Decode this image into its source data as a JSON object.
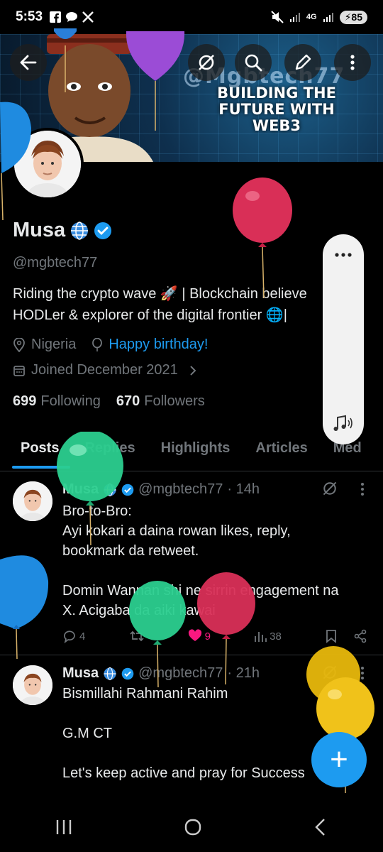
{
  "status_bar": {
    "time": "5:53",
    "network": "4G",
    "battery": "85"
  },
  "banner": {
    "handle_watermark": "@Mgbtech77",
    "title": "BUILDING THE\nFUTURE WITH\nWEB3"
  },
  "profile": {
    "display_name": "Musa",
    "handle": "@mgbtech77",
    "bio_line1": "Riding the crypto wave 🚀  | Blockchain believe",
    "bio_line2": "HODLer & explorer of the digital frontier 🌐|",
    "location": "Nigeria",
    "birthday_link": "Happy birthday!",
    "joined": "Joined December 2021",
    "following_count": "699",
    "following_label": "Following",
    "followers_count": "670",
    "followers_label": "Followers"
  },
  "tabs": [
    "Posts",
    "Replies",
    "Highlights",
    "Articles",
    "Med"
  ],
  "posts": [
    {
      "name": "Musa",
      "handle": "@mgbtech77",
      "time": "· 14h",
      "body": "Bro-to-Bro:\nAyi kokari a daina rowan likes, reply,\nbookmark da retweet.\n\nDomin Wannan shi ne sirrin engagement na\nX. Acigaba da aiki kawai",
      "replies": "4",
      "likes": "9",
      "views": "38"
    },
    {
      "name": "Musa",
      "handle": "@mgbtech77",
      "time": "· 21h",
      "body": "Bismillahi Rahmani Rahim\n\nG.M CT\n\nLet's keep active and pray for Success"
    }
  ],
  "fab_label": "+",
  "colors": {
    "accent": "#1d9bf0",
    "like": "#f91880",
    "muted": "#71767b",
    "background": "#000000"
  }
}
